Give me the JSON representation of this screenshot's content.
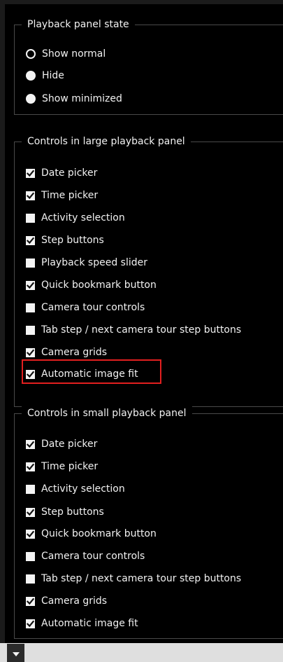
{
  "playback_state": {
    "title": "Playback panel state",
    "options": [
      {
        "label": "Show normal",
        "selected": true
      },
      {
        "label": "Hide",
        "selected": false
      },
      {
        "label": "Show minimized",
        "selected": false
      }
    ]
  },
  "large_panel": {
    "title": "Controls in large playback panel",
    "items": [
      {
        "label": "Date picker",
        "checked": true
      },
      {
        "label": "Time picker",
        "checked": true
      },
      {
        "label": "Activity selection",
        "checked": false
      },
      {
        "label": "Step buttons",
        "checked": true
      },
      {
        "label": "Playback speed slider",
        "checked": false
      },
      {
        "label": "Quick bookmark button",
        "checked": true
      },
      {
        "label": "Camera tour controls",
        "checked": false
      },
      {
        "label": "Tab step / next camera tour step buttons",
        "checked": false
      },
      {
        "label": "Camera grids",
        "checked": true
      },
      {
        "label": "Automatic image fit",
        "checked": true,
        "highlighted": true
      }
    ]
  },
  "small_panel": {
    "title": "Controls in small playback panel",
    "items": [
      {
        "label": "Date picker",
        "checked": true
      },
      {
        "label": "Time picker",
        "checked": true
      },
      {
        "label": "Activity selection",
        "checked": false
      },
      {
        "label": "Step buttons",
        "checked": true
      },
      {
        "label": "Quick bookmark button",
        "checked": true
      },
      {
        "label": "Camera tour controls",
        "checked": false
      },
      {
        "label": "Tab step / next camera tour step buttons",
        "checked": false
      },
      {
        "label": "Camera grids",
        "checked": true
      },
      {
        "label": "Automatic image fit",
        "checked": true
      }
    ]
  },
  "colors": {
    "highlight": "#e21f1f",
    "background": "#000000",
    "text": "#f2f2f2"
  },
  "footer": {
    "toggle_icon": "caret-down-icon"
  }
}
